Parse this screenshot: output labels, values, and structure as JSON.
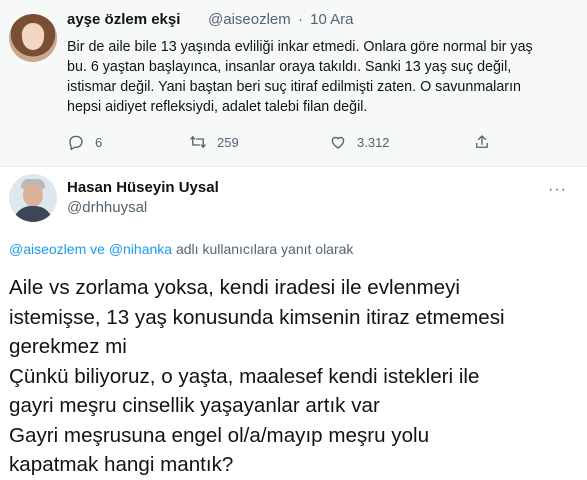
{
  "tweet1": {
    "author_name": "ayşe özlem ekşi",
    "handle": "@aiseozlem",
    "separator": "·",
    "date": "10 Ara",
    "lines": [
      "Bir de aile bile 13 yaşında evliliği inkar etmedi. Onlara göre normal bir yaş",
      "bu. 6 yaştan başlayınca, insanlar oraya takıldı. Sanki 13 yaş suç değil,",
      "istismar değil. Yani baştan beri suç itiraf edilmişti zaten. O savunmaların",
      "hepsi aidiyet refleksiydi, adalet talebi filan değil."
    ],
    "reply_count": "6",
    "retweet_count": "259",
    "like_count": "3.312"
  },
  "tweet2": {
    "author_name": "Hasan Hüseyin Uysal",
    "handle": "@drhhuysal",
    "more_label": "···",
    "replying_to_user1": "@aiseozlem",
    "replying_and": "ve",
    "replying_to_user2": "@nihanka",
    "replying_suffix": "adlı kullanıcılara yanıt olarak",
    "lines": [
      "Aile vs zorlama yoksa, kendi iradesi ile evlenmeyi",
      "istemişse, 13 yaş konusunda kimsenin itiraz etmemesi",
      "gerekmez mi",
      "Çünkü biliyoruz, o yaşta, maalesef kendi istekleri ile",
      "gayri meşru cinsellik yaşayanlar artık var",
      "Gayri meşrusuna engel ol/a/mayıp meşru yolu",
      "kapatmak hangi mantık?"
    ]
  },
  "icons": {
    "reply": "reply-icon",
    "retweet": "retweet-icon",
    "like": "like-icon",
    "share": "share-icon"
  },
  "colors": {
    "link": "#1d9bf0",
    "secondary_text": "#536471",
    "quoted_background": "#f7f9f9"
  }
}
